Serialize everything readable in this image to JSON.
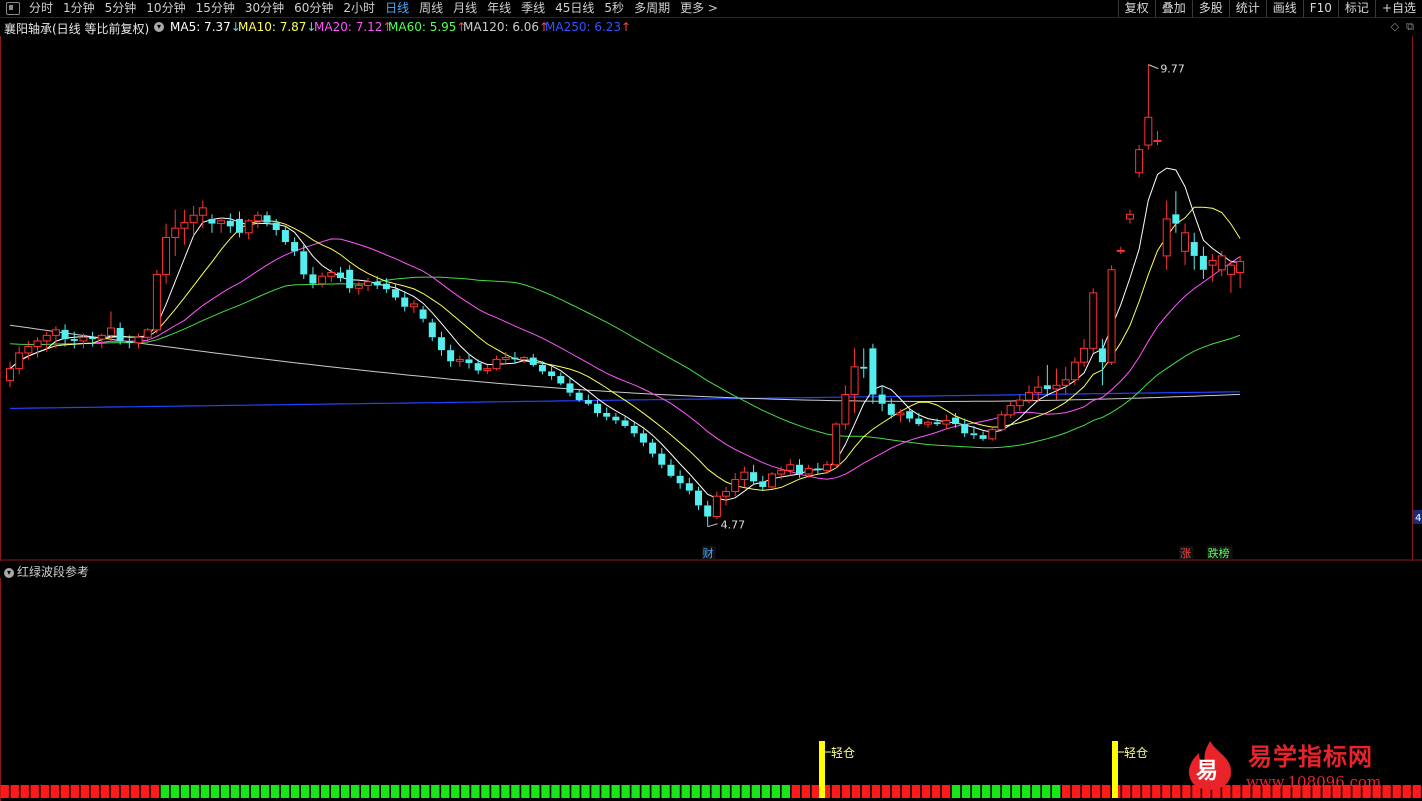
{
  "topbar": {
    "tabs": [
      "分时",
      "1分钟",
      "5分钟",
      "10分钟",
      "15分钟",
      "30分钟",
      "60分钟",
      "2小时",
      "日线",
      "周线",
      "月线",
      "年线",
      "季线",
      "45日线",
      "5秒",
      "多周期",
      "更多 >"
    ],
    "active_tab": "日线",
    "tools": [
      "复权",
      "叠加",
      "多股",
      "统计",
      "画线",
      "F10",
      "标记",
      "+自选"
    ]
  },
  "stock": {
    "title": "襄阳轴承(日线 等比前复权)",
    "ma": [
      {
        "label": "MA5: 7.37",
        "arrow": "↓",
        "color": "#ffffff"
      },
      {
        "label": "MA10: 7.87",
        "arrow": "↓",
        "color": "#ffff55"
      },
      {
        "label": "MA20: 7.12",
        "arrow": "↑",
        "color": "#ff55ff"
      },
      {
        "label": "MA60: 5.95",
        "arrow": "↑",
        "color": "#55ff55"
      },
      {
        "label": "MA120: 6.06",
        "arrow": "↑",
        "color": "#cccccc"
      },
      {
        "label": "MA250: 6.23",
        "arrow": "↑",
        "color": "#3355ff"
      }
    ]
  },
  "chart_data": {
    "type": "candlestick",
    "high_label": "9.77",
    "low_label": "4.77",
    "ohlc": [
      [
        6.35,
        6.55,
        6.28,
        6.48
      ],
      [
        6.48,
        6.72,
        6.42,
        6.65
      ],
      [
        6.65,
        6.78,
        6.58,
        6.72
      ],
      [
        6.72,
        6.82,
        6.6,
        6.78
      ],
      [
        6.78,
        6.88,
        6.66,
        6.84
      ],
      [
        6.84,
        6.94,
        6.7,
        6.9
      ],
      [
        6.9,
        6.96,
        6.72,
        6.8
      ],
      [
        6.8,
        6.88,
        6.7,
        6.78
      ],
      [
        6.78,
        6.86,
        6.7,
        6.82
      ],
      [
        6.82,
        6.88,
        6.72,
        6.8
      ],
      [
        6.8,
        6.86,
        6.7,
        6.84
      ],
      [
        6.84,
        7.1,
        6.78,
        6.92
      ],
      [
        6.92,
        6.98,
        6.74,
        6.78
      ],
      [
        6.78,
        6.84,
        6.7,
        6.76
      ],
      [
        6.76,
        6.86,
        6.7,
        6.82
      ],
      [
        6.82,
        6.92,
        6.76,
        6.9
      ],
      [
        6.9,
        7.55,
        6.86,
        7.5
      ],
      [
        7.5,
        8.05,
        7.4,
        7.9
      ],
      [
        7.9,
        8.2,
        7.7,
        8.0
      ],
      [
        8.0,
        8.2,
        7.82,
        8.06
      ],
      [
        8.06,
        8.24,
        7.92,
        8.14
      ],
      [
        8.14,
        8.3,
        8.0,
        8.22
      ],
      [
        8.1,
        8.15,
        7.95,
        8.05
      ],
      [
        8.05,
        8.12,
        7.95,
        8.08
      ],
      [
        8.08,
        8.16,
        7.95,
        8.02
      ],
      [
        8.1,
        8.18,
        7.9,
        7.95
      ],
      [
        7.95,
        8.1,
        7.88,
        8.08
      ],
      [
        8.08,
        8.18,
        8.0,
        8.14
      ],
      [
        8.14,
        8.18,
        8.02,
        8.06
      ],
      [
        8.06,
        8.1,
        7.92,
        7.98
      ],
      [
        7.98,
        8.02,
        7.82,
        7.85
      ],
      [
        7.85,
        7.9,
        7.7,
        7.75
      ],
      [
        7.75,
        7.82,
        7.45,
        7.5
      ],
      [
        7.5,
        7.58,
        7.35,
        7.4
      ],
      [
        7.4,
        7.52,
        7.36,
        7.48
      ],
      [
        7.48,
        7.56,
        7.42,
        7.52
      ],
      [
        7.52,
        7.58,
        7.42,
        7.46
      ],
      [
        7.55,
        7.6,
        7.3,
        7.35
      ],
      [
        7.35,
        7.42,
        7.28,
        7.38
      ],
      [
        7.38,
        7.46,
        7.32,
        7.42
      ],
      [
        7.42,
        7.48,
        7.34,
        7.38
      ],
      [
        7.4,
        7.46,
        7.3,
        7.34
      ],
      [
        7.34,
        7.4,
        7.22,
        7.25
      ],
      [
        7.25,
        7.32,
        7.1,
        7.15
      ],
      [
        7.15,
        7.22,
        7.08,
        7.18
      ],
      [
        7.12,
        7.16,
        6.98,
        7.02
      ],
      [
        6.98,
        7.02,
        6.78,
        6.82
      ],
      [
        6.82,
        6.88,
        6.62,
        6.68
      ],
      [
        6.68,
        6.74,
        6.5,
        6.56
      ],
      [
        6.56,
        6.62,
        6.5,
        6.58
      ],
      [
        6.58,
        6.64,
        6.48,
        6.54
      ],
      [
        6.54,
        6.58,
        6.42,
        6.46
      ],
      [
        6.46,
        6.52,
        6.42,
        6.48
      ],
      [
        6.48,
        6.62,
        6.46,
        6.58
      ],
      [
        6.58,
        6.66,
        6.52,
        6.6
      ],
      [
        6.6,
        6.66,
        6.54,
        6.58
      ],
      [
        6.58,
        6.62,
        6.54,
        6.6
      ],
      [
        6.6,
        6.64,
        6.5,
        6.52
      ],
      [
        6.52,
        6.56,
        6.42,
        6.45
      ],
      [
        6.45,
        6.5,
        6.36,
        6.4
      ],
      [
        6.4,
        6.44,
        6.3,
        6.32
      ],
      [
        6.32,
        6.38,
        6.18,
        6.22
      ],
      [
        6.22,
        6.26,
        6.12,
        6.14
      ],
      [
        6.14,
        6.2,
        6.08,
        6.1
      ],
      [
        6.1,
        6.14,
        5.96,
        6.0
      ],
      [
        6.0,
        6.06,
        5.92,
        5.96
      ],
      [
        5.96,
        6.0,
        5.88,
        5.92
      ],
      [
        5.92,
        5.96,
        5.84,
        5.86
      ],
      [
        5.86,
        5.9,
        5.74,
        5.78
      ],
      [
        5.78,
        5.82,
        5.64,
        5.68
      ],
      [
        5.68,
        5.72,
        5.52,
        5.56
      ],
      [
        5.56,
        5.62,
        5.4,
        5.44
      ],
      [
        5.44,
        5.5,
        5.3,
        5.32
      ],
      [
        5.32,
        5.38,
        5.18,
        5.24
      ],
      [
        5.24,
        5.3,
        5.12,
        5.16
      ],
      [
        5.16,
        5.2,
        4.95,
        5.0
      ],
      [
        5.0,
        5.05,
        4.77,
        4.88
      ],
      [
        4.88,
        5.15,
        4.85,
        5.1
      ],
      [
        5.1,
        5.2,
        5.0,
        5.15
      ],
      [
        5.15,
        5.35,
        5.1,
        5.28
      ],
      [
        5.28,
        5.42,
        5.2,
        5.36
      ],
      [
        5.36,
        5.44,
        5.22,
        5.26
      ],
      [
        5.26,
        5.32,
        5.16,
        5.2
      ],
      [
        5.2,
        5.36,
        5.18,
        5.34
      ],
      [
        5.34,
        5.42,
        5.28,
        5.38
      ],
      [
        5.38,
        5.5,
        5.32,
        5.44
      ],
      [
        5.44,
        5.5,
        5.3,
        5.34
      ],
      [
        5.34,
        5.44,
        5.3,
        5.4
      ],
      [
        5.4,
        5.46,
        5.34,
        5.38
      ],
      [
        5.38,
        5.48,
        5.34,
        5.44
      ],
      [
        5.44,
        5.9,
        5.4,
        5.88
      ],
      [
        5.88,
        6.3,
        5.82,
        6.2
      ],
      [
        6.2,
        6.7,
        6.0,
        6.5
      ],
      [
        6.5,
        6.7,
        6.38,
        6.48
      ],
      [
        6.7,
        6.75,
        6.1,
        6.2
      ],
      [
        6.2,
        6.3,
        6.02,
        6.1
      ],
      [
        6.1,
        6.16,
        5.94,
        5.98
      ],
      [
        5.98,
        6.04,
        5.9,
        6.0
      ],
      [
        6.02,
        6.06,
        5.9,
        5.94
      ],
      [
        5.94,
        6.0,
        5.86,
        5.88
      ],
      [
        5.88,
        5.92,
        5.84,
        5.9
      ],
      [
        5.9,
        5.94,
        5.86,
        5.88
      ],
      [
        5.88,
        5.98,
        5.82,
        5.92
      ],
      [
        5.95,
        6.0,
        5.84,
        5.88
      ],
      [
        5.88,
        5.94,
        5.74,
        5.78
      ],
      [
        5.78,
        5.86,
        5.72,
        5.76
      ],
      [
        5.76,
        5.8,
        5.7,
        5.72
      ],
      [
        5.72,
        5.84,
        5.7,
        5.82
      ],
      [
        5.82,
        6.02,
        5.8,
        5.98
      ],
      [
        5.98,
        6.12,
        5.95,
        6.08
      ],
      [
        6.08,
        6.2,
        6.02,
        6.14
      ],
      [
        6.14,
        6.3,
        6.1,
        6.22
      ],
      [
        6.22,
        6.4,
        6.12,
        6.28
      ],
      [
        6.3,
        6.52,
        6.18,
        6.26
      ],
      [
        6.26,
        6.48,
        6.14,
        6.3
      ],
      [
        6.3,
        6.5,
        6.2,
        6.36
      ],
      [
        6.36,
        6.6,
        6.3,
        6.55
      ],
      [
        6.55,
        6.8,
        6.5,
        6.7
      ],
      [
        6.7,
        7.35,
        6.65,
        7.3
      ],
      [
        6.7,
        6.8,
        6.3,
        6.55
      ],
      [
        6.55,
        7.6,
        6.52,
        7.55
      ],
      [
        7.75,
        7.8,
        7.72,
        7.76
      ],
      [
        8.1,
        8.2,
        8.05,
        8.15
      ],
      [
        8.6,
        8.9,
        8.55,
        8.85
      ],
      [
        8.9,
        9.77,
        8.85,
        9.2
      ],
      [
        8.95,
        9.05,
        8.9,
        8.95
      ],
      [
        7.7,
        8.3,
        7.55,
        8.1
      ],
      [
        8.15,
        8.4,
        7.95,
        8.05
      ],
      [
        7.75,
        8.05,
        7.6,
        7.95
      ],
      [
        7.85,
        7.95,
        7.55,
        7.7
      ],
      [
        7.7,
        7.8,
        7.45,
        7.55
      ],
      [
        7.6,
        7.72,
        7.42,
        7.65
      ],
      [
        7.55,
        7.75,
        7.48,
        7.7
      ],
      [
        7.5,
        7.65,
        7.3,
        7.6
      ],
      [
        7.52,
        7.7,
        7.35,
        7.64
      ]
    ],
    "ma250_start": 6.05,
    "ma250_end": 6.23,
    "ma120_start": 6.95,
    "ma120_end": 6.06,
    "events": [
      {
        "index": 76,
        "label": "财",
        "color": "#4aa8ff"
      },
      {
        "index": 128,
        "label": "涨",
        "color": "#ff4444"
      },
      {
        "index": 131,
        "label": "跌榜",
        "color": "#55ff55"
      }
    ],
    "right_edge_label": "4"
  },
  "subchart": {
    "title": "红绿波段参考",
    "signal_label": "轻仓",
    "signals": [
      76,
      105
    ],
    "bars_total": 142,
    "bands": [
      {
        "from": 0,
        "to": 15,
        "color": "red"
      },
      {
        "from": 16,
        "to": 78,
        "color": "green"
      },
      {
        "from": 79,
        "to": 94,
        "color": "red"
      },
      {
        "from": 95,
        "to": 105,
        "color": "green"
      },
      {
        "from": 106,
        "to": 141,
        "color": "red"
      }
    ]
  },
  "watermark": {
    "logo_char": "易",
    "text": "易学指标网",
    "url": "www.108096.com"
  },
  "colors": {
    "up": "#ff3333",
    "down": "#55eeee",
    "ma5": "#ffffff",
    "ma10": "#ffff55",
    "ma20": "#ff55ff",
    "ma60": "#44dd44",
    "ma120": "#cccccc",
    "ma250": "#2244ff"
  }
}
